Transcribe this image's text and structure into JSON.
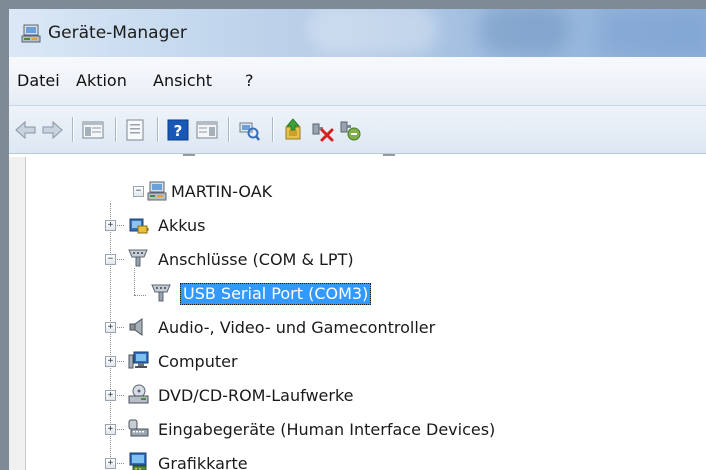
{
  "window": {
    "title": "Geräte-Manager",
    "app_icon": "device-manager-icon"
  },
  "menu": [
    "Datei",
    "Aktion",
    "Ansicht",
    "?"
  ],
  "toolbar": {
    "buttons": [
      "back-icon",
      "forward-icon",
      "show-hide-console-tree-icon",
      "properties-icon",
      "help-icon",
      "action-pane-icon",
      "scan-hardware-icon",
      "update-driver-icon",
      "uninstall-icon",
      "disable-device-icon"
    ]
  },
  "tree": {
    "root": {
      "label": "MARTIN-OAK",
      "icon": "computer-network-icon",
      "expanded": true
    },
    "categories": [
      {
        "label": "Akkus",
        "icon": "battery-icon",
        "expanded": false
      },
      {
        "label": "Anschlüsse (COM & LPT)",
        "icon": "port-icon",
        "expanded": true,
        "children": [
          {
            "label": "USB Serial Port (COM3)",
            "icon": "port-icon",
            "selected": true
          }
        ]
      },
      {
        "label": "Audio-, Video- und Gamecontroller",
        "icon": "speaker-icon",
        "expanded": false
      },
      {
        "label": "Computer",
        "icon": "monitor-icon",
        "expanded": false
      },
      {
        "label": "DVD/CD-ROM-Laufwerke",
        "icon": "dvd-drive-icon",
        "expanded": false
      },
      {
        "label": "Eingabegeräte (Human Interface Devices)",
        "icon": "keyboard-icon",
        "expanded": false
      },
      {
        "label": "Grafikkarte",
        "icon": "display-adapter-icon",
        "expanded": false
      }
    ]
  },
  "colors": {
    "selection": "#3399ff",
    "titlebar_start": "#dbe8f6",
    "titlebar_end": "#8eb1da"
  }
}
